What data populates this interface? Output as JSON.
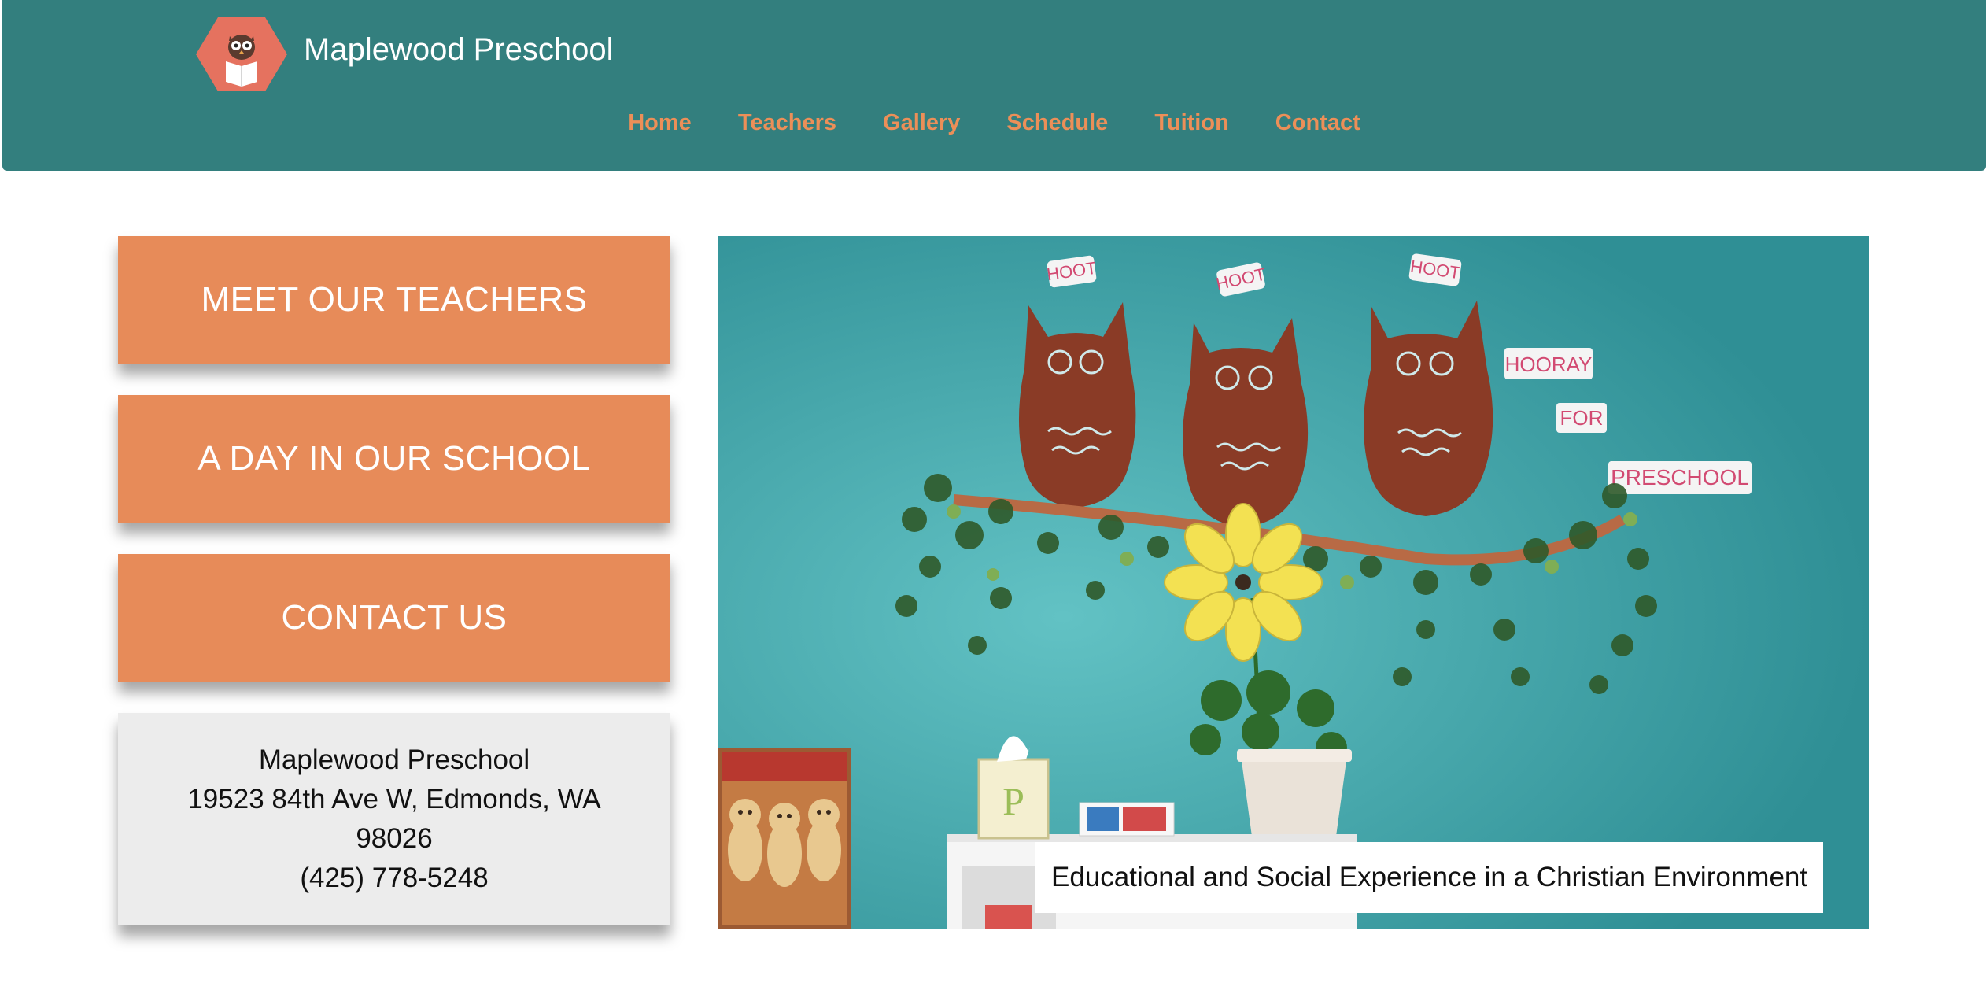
{
  "header": {
    "brand": "Maplewood Preschool",
    "logo_icon": "owl-reading-book-icon",
    "nav": [
      "Home",
      "Teachers",
      "Gallery",
      "Schedule",
      "Tuition",
      "Contact"
    ]
  },
  "sidebar": {
    "buttons": [
      "MEET OUR TEACHERS",
      "A DAY IN OUR SCHOOL",
      "CONTACT US"
    ],
    "address": {
      "name": "Maplewood Preschool",
      "street": "19523 84th Ave W, Edmonds, WA",
      "zip": "98026",
      "phone": "(425) 778-5248"
    }
  },
  "hero": {
    "signs": [
      "HOOT",
      "HOOT",
      "HOOT",
      "HOORAY",
      "FOR",
      "PRESCHOOL"
    ],
    "block_letter": "P",
    "caption": "Educational and Social Experience in a Christian Environment"
  },
  "colors": {
    "header_bg": "#337f7e",
    "nav_link": "#ec8f58",
    "button_bg": "#e78b59",
    "address_bg": "#ececec",
    "wall": "#3d9ea3"
  }
}
